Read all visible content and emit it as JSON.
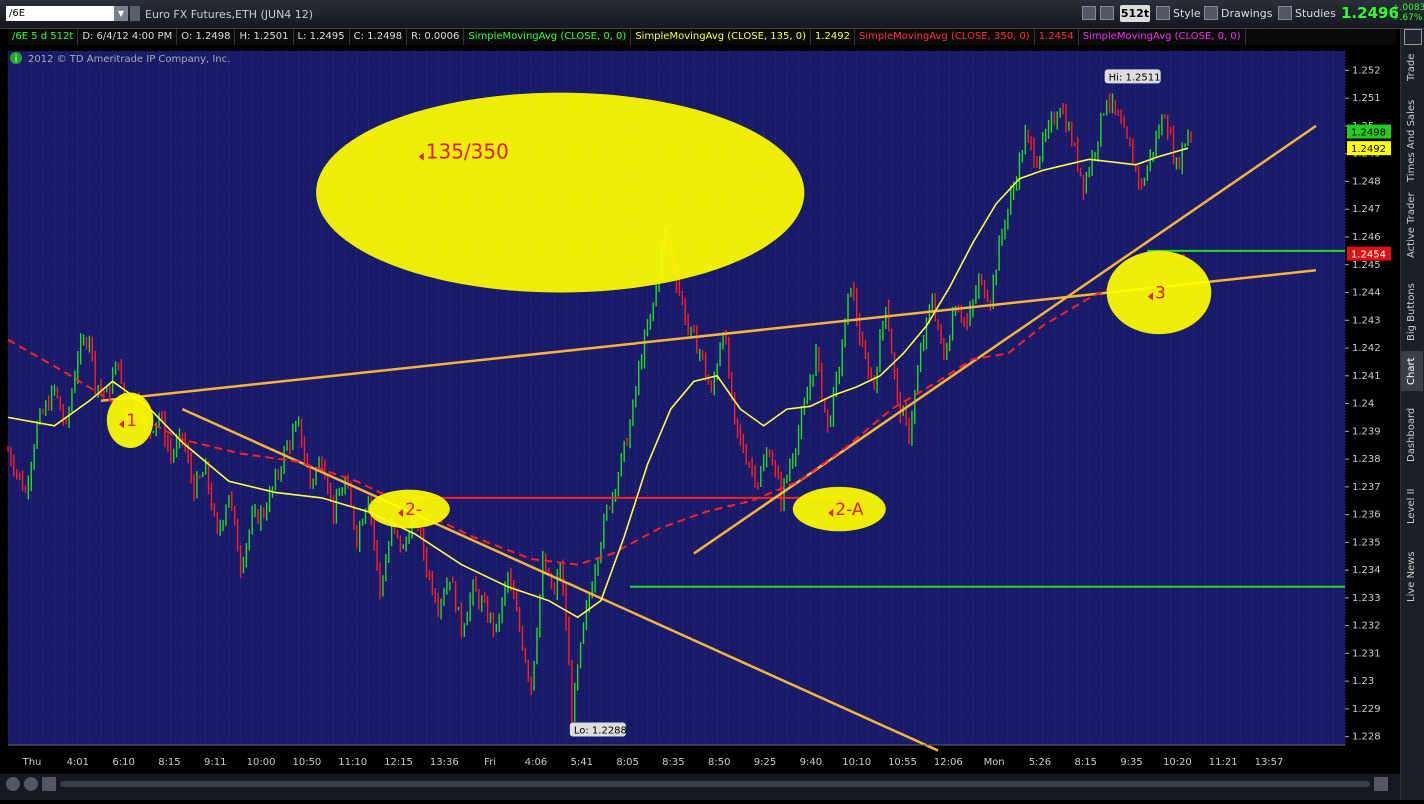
{
  "toolbar": {
    "symbol": "/6E",
    "instrument": "Euro FX Futures,ETH (JUN4 12)",
    "aggregation_badge": "512t",
    "style_label": "Style",
    "drawings_label": "Drawings",
    "studies_label": "Studies",
    "last_price": "1.2496",
    "change_1": "+.0083",
    "change_2": "+.67%"
  },
  "infobar": {
    "symbol_period": "/6E 5 d 512t",
    "date": "D: 6/4/12 4:00 PM",
    "open": "O: 1.2498",
    "high": "H: 1.2501",
    "low": "L: 1.2495",
    "close": "C: 1.2498",
    "range": "R: 0.0006",
    "sma1_label": "SimpleMovingAvg (CLOSE, 0, 0)",
    "sma2_label": "SimpleMovingAvg (CLOSE, 135, 0)",
    "sma2_value": "1.2492",
    "sma3_label": "SimpleMovingAvg (CLOSE, 350, 0)",
    "sma3_value": "1.2454",
    "sma4_label": "SimpleMovingAvg (CLOSE, 0, 0)",
    "copyright": "2012 © TD Ameritrade IP Company, Inc."
  },
  "sidebar": {
    "tabs": [
      "Trade",
      "Times And Sales",
      "Active Trader",
      "Big Buttons",
      "Chart",
      "Dashboard",
      "Level II",
      "Live News"
    ]
  },
  "chart_data": {
    "type": "line",
    "title": "",
    "ylim": [
      1.2277,
      1.2527
    ],
    "y_ticks": [
      "1.252",
      "1.251",
      "1.25",
      "1.249",
      "1.248",
      "1.247",
      "1.246",
      "1.245",
      "1.244",
      "1.243",
      "1.242",
      "1.241",
      "1.24",
      "1.239",
      "1.238",
      "1.237",
      "1.236",
      "1.235",
      "1.234",
      "1.233",
      "1.232",
      "1.231",
      "1.23",
      "1.229",
      "1.228"
    ],
    "x_ticks": [
      "Thu",
      "4:01",
      "6:10",
      "8:15",
      "9:11",
      "10:00",
      "10:50",
      "11:10",
      "12:15",
      "13:36",
      "Fri",
      "4:06",
      "5:41",
      "8:05",
      "8:35",
      "8:50",
      "9:25",
      "9:40",
      "10:10",
      "10:55",
      "12:06",
      "Mon",
      "5:26",
      "8:15",
      "9:35",
      "10:20",
      "11:21",
      "13:57"
    ],
    "price_path": [
      [
        0,
        1.2383
      ],
      [
        3,
        1.2368
      ],
      [
        5,
        1.2392
      ],
      [
        8,
        1.2405
      ],
      [
        10,
        1.2391
      ],
      [
        12,
        1.2418
      ],
      [
        14,
        1.2425
      ],
      [
        15,
        1.2408
      ],
      [
        17,
        1.2403
      ],
      [
        19,
        1.2416
      ],
      [
        20,
        1.2395
      ],
      [
        22,
        1.2402
      ],
      [
        24,
        1.2389
      ],
      [
        26,
        1.2396
      ],
      [
        28,
        1.2381
      ],
      [
        30,
        1.2388
      ],
      [
        32,
        1.2369
      ],
      [
        34,
        1.2376
      ],
      [
        36,
        1.2352
      ],
      [
        38,
        1.2368
      ],
      [
        40,
        1.2342
      ],
      [
        42,
        1.2358
      ],
      [
        44,
        1.2361
      ],
      [
        46,
        1.2372
      ],
      [
        48,
        1.2385
      ],
      [
        50,
        1.2392
      ],
      [
        52,
        1.2371
      ],
      [
        54,
        1.2381
      ],
      [
        56,
        1.2361
      ],
      [
        58,
        1.2372
      ],
      [
        60,
        1.2352
      ],
      [
        62,
        1.2368
      ],
      [
        64,
        1.2332
      ],
      [
        66,
        1.2355
      ],
      [
        68,
        1.2347
      ],
      [
        70,
        1.2362
      ],
      [
        72,
        1.2341
      ],
      [
        74,
        1.2328
      ],
      [
        76,
        1.2338
      ],
      [
        78,
        1.2319
      ],
      [
        80,
        1.2333
      ],
      [
        82,
        1.2326
      ],
      [
        84,
        1.2318
      ],
      [
        86,
        1.2338
      ],
      [
        88,
        1.2319
      ],
      [
        90,
        1.2298
      ],
      [
        92,
        1.2342
      ],
      [
        94,
        1.2331
      ],
      [
        95,
        1.2342
      ],
      [
        96,
        1.2321
      ],
      [
        97,
        1.2288
      ],
      [
        99,
        1.2319
      ],
      [
        101,
        1.2342
      ],
      [
        103,
        1.2361
      ],
      [
        105,
        1.2375
      ],
      [
        107,
        1.2392
      ],
      [
        109,
        1.2418
      ],
      [
        111,
        1.2435
      ],
      [
        113,
        1.2462
      ],
      [
        115,
        1.2445
      ],
      [
        117,
        1.2427
      ],
      [
        119,
        1.2419
      ],
      [
        121,
        1.2403
      ],
      [
        123,
        1.2428
      ],
      [
        125,
        1.2392
      ],
      [
        127,
        1.2381
      ],
      [
        129,
        1.2372
      ],
      [
        131,
        1.2384
      ],
      [
        133,
        1.2366
      ],
      [
        135,
        1.2382
      ],
      [
        137,
        1.2398
      ],
      [
        139,
        1.2418
      ],
      [
        141,
        1.2391
      ],
      [
        143,
        1.2413
      ],
      [
        145,
        1.2444
      ],
      [
        147,
        1.2418
      ],
      [
        149,
        1.2407
      ],
      [
        151,
        1.2437
      ],
      [
        153,
        1.2401
      ],
      [
        155,
        1.2389
      ],
      [
        157,
        1.2418
      ],
      [
        159,
        1.2438
      ],
      [
        161,
        1.2416
      ],
      [
        163,
        1.2437
      ],
      [
        165,
        1.2428
      ],
      [
        167,
        1.2444
      ],
      [
        169,
        1.2438
      ],
      [
        171,
        1.2462
      ],
      [
        173,
        1.2478
      ],
      [
        175,
        1.2496
      ],
      [
        177,
        1.2488
      ],
      [
        179,
        1.2498
      ],
      [
        181,
        1.2508
      ],
      [
        183,
        1.2495
      ],
      [
        185,
        1.2479
      ],
      [
        187,
        1.2492
      ],
      [
        189,
        1.2511
      ],
      [
        191,
        1.2502
      ],
      [
        193,
        1.2491
      ],
      [
        195,
        1.2478
      ],
      [
        197,
        1.2492
      ],
      [
        199,
        1.2505
      ],
      [
        201,
        1.2485
      ],
      [
        203,
        1.2498
      ]
    ],
    "n_bars": 204,
    "sma135_path": [
      [
        0,
        1.2395
      ],
      [
        8,
        1.2392
      ],
      [
        14,
        1.2401
      ],
      [
        18,
        1.2408
      ],
      [
        24,
        1.2399
      ],
      [
        30,
        1.2386
      ],
      [
        38,
        1.2372
      ],
      [
        46,
        1.2368
      ],
      [
        54,
        1.2366
      ],
      [
        62,
        1.2361
      ],
      [
        70,
        1.2353
      ],
      [
        78,
        1.2342
      ],
      [
        86,
        1.2334
      ],
      [
        93,
        1.2329
      ],
      [
        98,
        1.2323
      ],
      [
        102,
        1.2329
      ],
      [
        106,
        1.2352
      ],
      [
        110,
        1.2378
      ],
      [
        114,
        1.2398
      ],
      [
        118,
        1.2408
      ],
      [
        122,
        1.241
      ],
      [
        126,
        1.2398
      ],
      [
        130,
        1.2392
      ],
      [
        134,
        1.2398
      ],
      [
        138,
        1.2399
      ],
      [
        142,
        1.2403
      ],
      [
        146,
        1.2406
      ],
      [
        150,
        1.241
      ],
      [
        154,
        1.2418
      ],
      [
        158,
        1.2428
      ],
      [
        162,
        1.2442
      ],
      [
        166,
        1.2458
      ],
      [
        170,
        1.2472
      ],
      [
        174,
        1.2481
      ],
      [
        178,
        1.2484
      ],
      [
        182,
        1.2486
      ],
      [
        186,
        1.2488
      ],
      [
        190,
        1.2487
      ],
      [
        194,
        1.2486
      ],
      [
        198,
        1.2489
      ],
      [
        203,
        1.2492
      ]
    ],
    "sma350_path": [
      [
        0,
        1.2423
      ],
      [
        10,
        1.2411
      ],
      [
        20,
        1.2398
      ],
      [
        30,
        1.2387
      ],
      [
        40,
        1.2382
      ],
      [
        50,
        1.2379
      ],
      [
        60,
        1.2372
      ],
      [
        70,
        1.2362
      ],
      [
        80,
        1.2352
      ],
      [
        90,
        1.2344
      ],
      [
        98,
        1.2342
      ],
      [
        104,
        1.2346
      ],
      [
        112,
        1.2355
      ],
      [
        120,
        1.2361
      ],
      [
        128,
        1.2365
      ],
      [
        136,
        1.2372
      ],
      [
        144,
        1.2384
      ],
      [
        152,
        1.2398
      ],
      [
        160,
        1.2408
      ],
      [
        166,
        1.2416
      ],
      [
        172,
        1.2418
      ],
      [
        178,
        1.2428
      ],
      [
        186,
        1.2438
      ],
      [
        194,
        1.2446
      ],
      [
        203,
        1.2454
      ]
    ],
    "trendlines": [
      {
        "color": "#f5b43a",
        "from": [
          16,
          1.2401
        ],
        "to": [
          225,
          1.2448
        ]
      },
      {
        "color": "#f5b43a",
        "from": [
          30,
          1.2398
        ],
        "to": [
          160,
          1.2275
        ]
      },
      {
        "color": "#f5b43a",
        "from": [
          118,
          1.2346
        ],
        "to": [
          225,
          1.25
        ]
      }
    ],
    "hlines": [
      {
        "color": "#ff2020",
        "y": 1.2366,
        "from": 68,
        "to": 143
      },
      {
        "color": "#22dd22",
        "y": 1.2455,
        "from": 196,
        "to": 230
      },
      {
        "color": "#22dd22",
        "y": 1.2334,
        "from": 107,
        "to": 230
      }
    ],
    "ellipses": [
      {
        "cx": 21,
        "cy": 1.2394,
        "rx": 4,
        "ry": 0.001,
        "label": "1"
      },
      {
        "cx": 69,
        "cy": 1.2362,
        "rx": 7,
        "ry": 0.0007,
        "label": "2-"
      },
      {
        "cx": 95,
        "cy": 1.2476,
        "rx": 42,
        "ry": 0.0036,
        "label": "135/350"
      },
      {
        "cx": 143,
        "cy": 1.2362,
        "rx": 8,
        "ry": 0.0008,
        "label": "2-A"
      },
      {
        "cx": 198,
        "cy": 1.244,
        "rx": 9,
        "ry": 0.0015,
        "label": "3"
      }
    ],
    "price_markers": [
      {
        "value": "1.2498",
        "color": "#22cc22",
        "text_color": "#000"
      },
      {
        "value": "1.2492",
        "color": "#ffff00",
        "text_color": "#000"
      },
      {
        "value": "1.2454",
        "color": "#dd1111",
        "text_color": "#fff"
      }
    ],
    "hi_label": "Hi: 1.2511",
    "lo_label": "Lo: 1.2288",
    "colors": {
      "up": "#22dd22",
      "down": "#ff2020",
      "sma135": "#ffff40",
      "sma350": "#ff2020",
      "trend": "#f5b43a",
      "ellipse": "#ffff00",
      "background": "#1a1a6a"
    }
  }
}
